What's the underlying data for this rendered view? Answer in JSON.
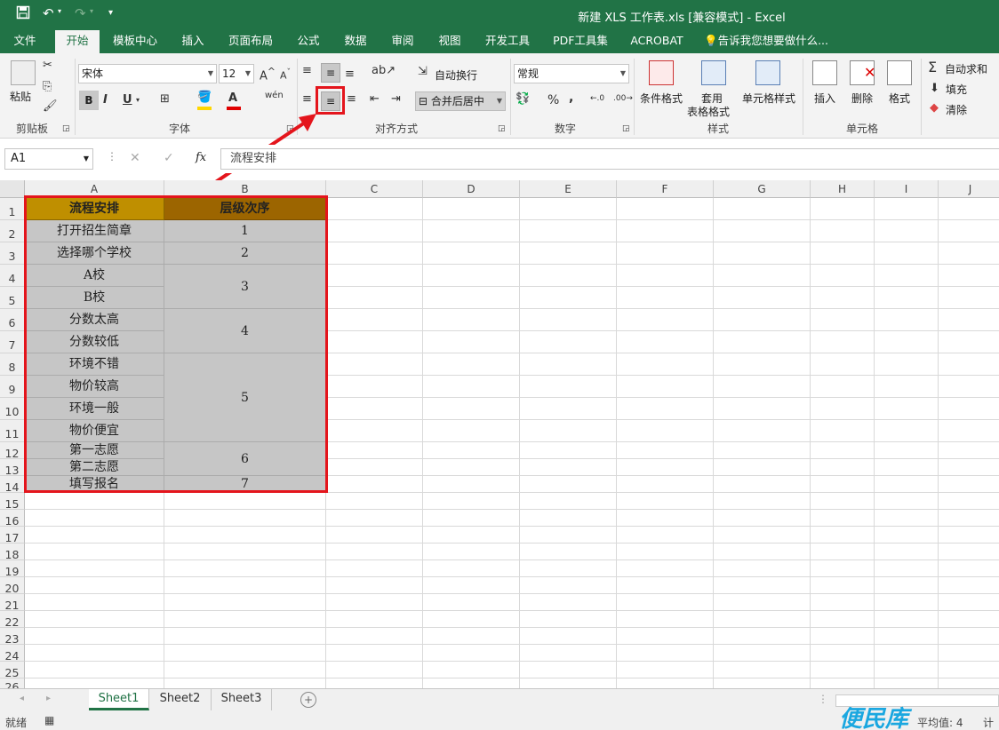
{
  "window": {
    "title": "新建 XLS 工作表.xls  [兼容模式] - Excel"
  },
  "quick_access": {
    "save_icon": "save-icon",
    "undo_icon": "undo-icon",
    "redo_icon": "redo-icon",
    "customize_icon": "customize-icon"
  },
  "tabs": [
    "文件",
    "开始",
    "模板中心",
    "插入",
    "页面布局",
    "公式",
    "数据",
    "审阅",
    "视图",
    "开发工具",
    "PDF工具集",
    "ACROBAT",
    "告诉我您想要做什么..."
  ],
  "active_tab": "开始",
  "ribbon": {
    "clipboard": {
      "paste": "粘贴",
      "group": "剪贴板"
    },
    "font": {
      "name": "宋体",
      "size": "12",
      "bold": "B",
      "italic": "I",
      "underline": "U",
      "group": "字体",
      "phonetic": "wén"
    },
    "alignment": {
      "wrap": "自动换行",
      "merge": "合并后居中",
      "group": "对齐方式"
    },
    "number": {
      "format": "常规",
      "percent": "%",
      "comma": ",",
      "group": "数字"
    },
    "styles": {
      "conditional": "条件格式",
      "table_1": "套用",
      "table_2": "表格格式",
      "cell_styles": "单元格样式",
      "group": "样式"
    },
    "cells": {
      "insert": "插入",
      "delete": "删除",
      "format": "格式",
      "group": "单元格"
    },
    "editing": {
      "autosum": "自动求和",
      "fill": "填充",
      "clear": "清除"
    }
  },
  "formula_bar": {
    "name_box": "A1",
    "fx": "fx",
    "content": "流程安排"
  },
  "columns": [
    "A",
    "B",
    "C",
    "D",
    "E",
    "F",
    "G",
    "H",
    "I",
    "J"
  ],
  "rows": [
    "1",
    "2",
    "3",
    "4",
    "5",
    "6",
    "7",
    "8",
    "9",
    "10",
    "11",
    "12",
    "13",
    "14",
    "15",
    "16",
    "17",
    "18",
    "19",
    "20",
    "21",
    "22",
    "23",
    "24",
    "25",
    "26"
  ],
  "table": {
    "header_a": "流程安排",
    "header_b": "层级次序",
    "col_a": [
      "打开招生简章",
      "选择哪个学校",
      "A校",
      "B校",
      "分数太高",
      "分数较低",
      "环境不错",
      "物价较高",
      "环境一般",
      "物价便宜",
      "第一志愿",
      "第二志愿",
      "填写报名"
    ],
    "col_b": [
      "1",
      "2",
      "3",
      "4",
      "5",
      "6",
      "7"
    ]
  },
  "sheets": [
    "Sheet1",
    "Sheet2",
    "Sheet3"
  ],
  "status": {
    "ready": "就绪",
    "average": "平均值: 4",
    "count": "计数",
    "watermark": "便民库"
  },
  "colors": {
    "excel_green": "#217346",
    "header_a_fill": "#bf8f00",
    "header_b_fill": "#9c6500",
    "cell_fill": "#c6c6c6",
    "highlight_red": "#e4151c"
  }
}
